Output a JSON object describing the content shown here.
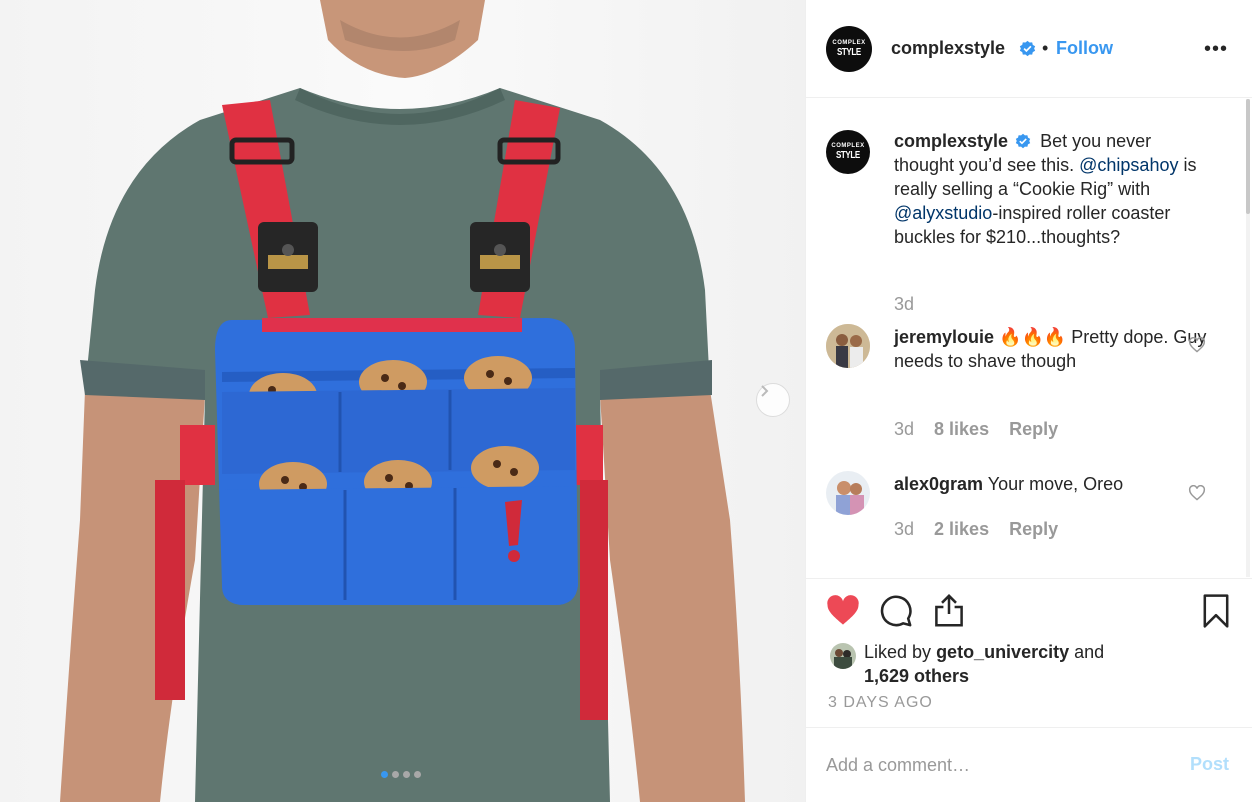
{
  "post": {
    "username": "complexstyle",
    "verified": true,
    "separator": "•",
    "follow_label": "Follow",
    "more_label": "•••",
    "logo_text_top": "COMPLEX",
    "logo_text_bottom": "STYLE",
    "carousel": {
      "slides": 4,
      "active_index": 0
    }
  },
  "caption": {
    "username": "complexstyle",
    "text_1": "Bet you never thought you’d see this.",
    "mention_1": "@chipsahoy",
    "text_2": "is really selling a “Cookie Rig” with",
    "mention_2": "@alyxstudio",
    "text_3": "-inspired roller coaster buckles for $210...thoughts?",
    "time": "3d"
  },
  "comments": [
    {
      "username": "jeremylouie",
      "text": "🔥🔥🔥 Pretty dope. Guy needs to shave though",
      "time": "3d",
      "likes": "8 likes",
      "reply_label": "Reply"
    },
    {
      "username": "alex0gram",
      "text": "Your move, Oreo",
      "time": "3d",
      "likes": "2 likes",
      "reply_label": "Reply"
    }
  ],
  "likes": {
    "liked_by_prefix": "Liked by",
    "liked_by_user": "geto_univercity",
    "liked_by_and": "and",
    "others": "1,629 others",
    "liked": true
  },
  "timestamp": "3 DAYS AGO",
  "add_comment": {
    "placeholder": "Add a comment…",
    "post_label": "Post"
  },
  "colors": {
    "accent": "#3897f0",
    "heart": "#ed4956",
    "mention": "#003569",
    "muted": "#999999"
  }
}
